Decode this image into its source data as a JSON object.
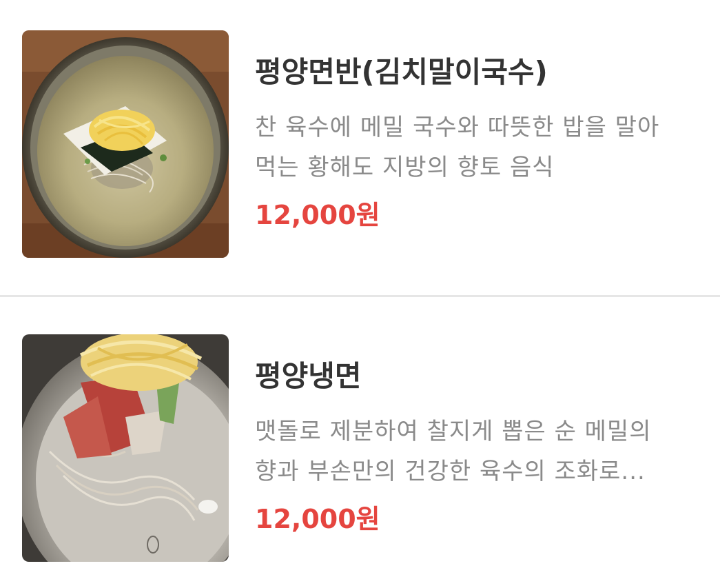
{
  "menu": {
    "items": [
      {
        "name": "평양면반(김치말이국수)",
        "desc_line1": "찬 육수에 메밀 국수와 따뜻한 밥을 말아",
        "desc_line2": "먹는 황해도 지방의 향토 음식",
        "price": "12,000원",
        "image_icon": "noodle-bowl-photo"
      },
      {
        "name": "평양냉면",
        "desc_line1": "맷돌로 제분하여 찰지게 뽑은 순 메밀의",
        "desc_line2": "향과 부손만의 건강한 육수의 조화로...",
        "price": "12,000원",
        "image_icon": "cold-noodle-photo"
      }
    ]
  },
  "colors": {
    "price": "#e5453f",
    "name": "#333333",
    "description": "#8a8a8a",
    "divider": "#e6e6e6"
  }
}
